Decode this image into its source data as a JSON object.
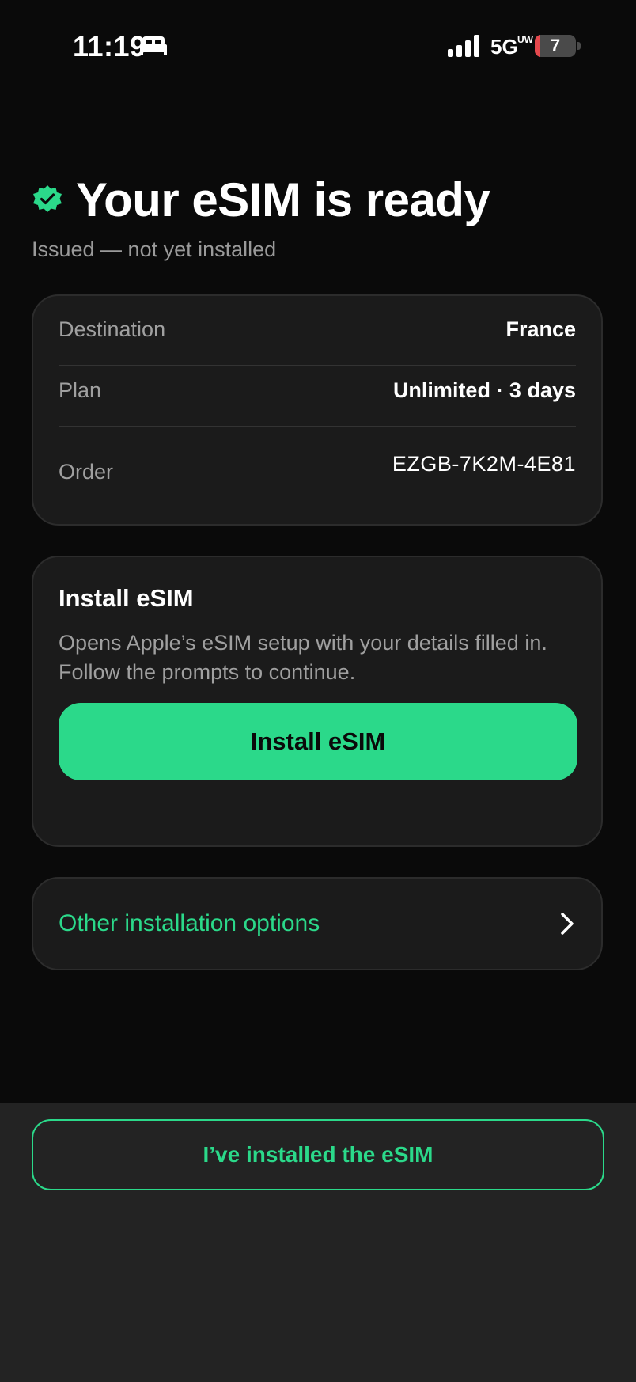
{
  "status_bar": {
    "time": "11:19",
    "network": "5G",
    "network_sup": "UW",
    "battery": "7",
    "icons": [
      "sleep-icon",
      "signal-icon",
      "battery-icon"
    ]
  },
  "header": {
    "title": "Your eSIM is ready",
    "subtitle": "Issued — not yet installed",
    "icon": "verified-badge-icon",
    "accent_color": "#2bd98a"
  },
  "details": {
    "rows": [
      {
        "label": "Destination",
        "value": "France"
      },
      {
        "label": "Plan",
        "value": "Unlimited · 3 days"
      },
      {
        "label": "Order",
        "value": "EZGB-7K2M-4E81"
      }
    ]
  },
  "install": {
    "title": "Install eSIM",
    "description": "Opens Apple’s eSIM setup with your details filled in. Follow the prompts to continue.",
    "button_label": "Install eSIM"
  },
  "options": {
    "label": "Other installation options",
    "icon": "chevron-right-icon"
  },
  "footer": {
    "installed_button_label": "I’ve installed the eSIM"
  },
  "colors": {
    "background": "#0a0a0a",
    "card": "#1b1b1b",
    "accent": "#2bd98a",
    "battery_low": "#e5484d"
  }
}
